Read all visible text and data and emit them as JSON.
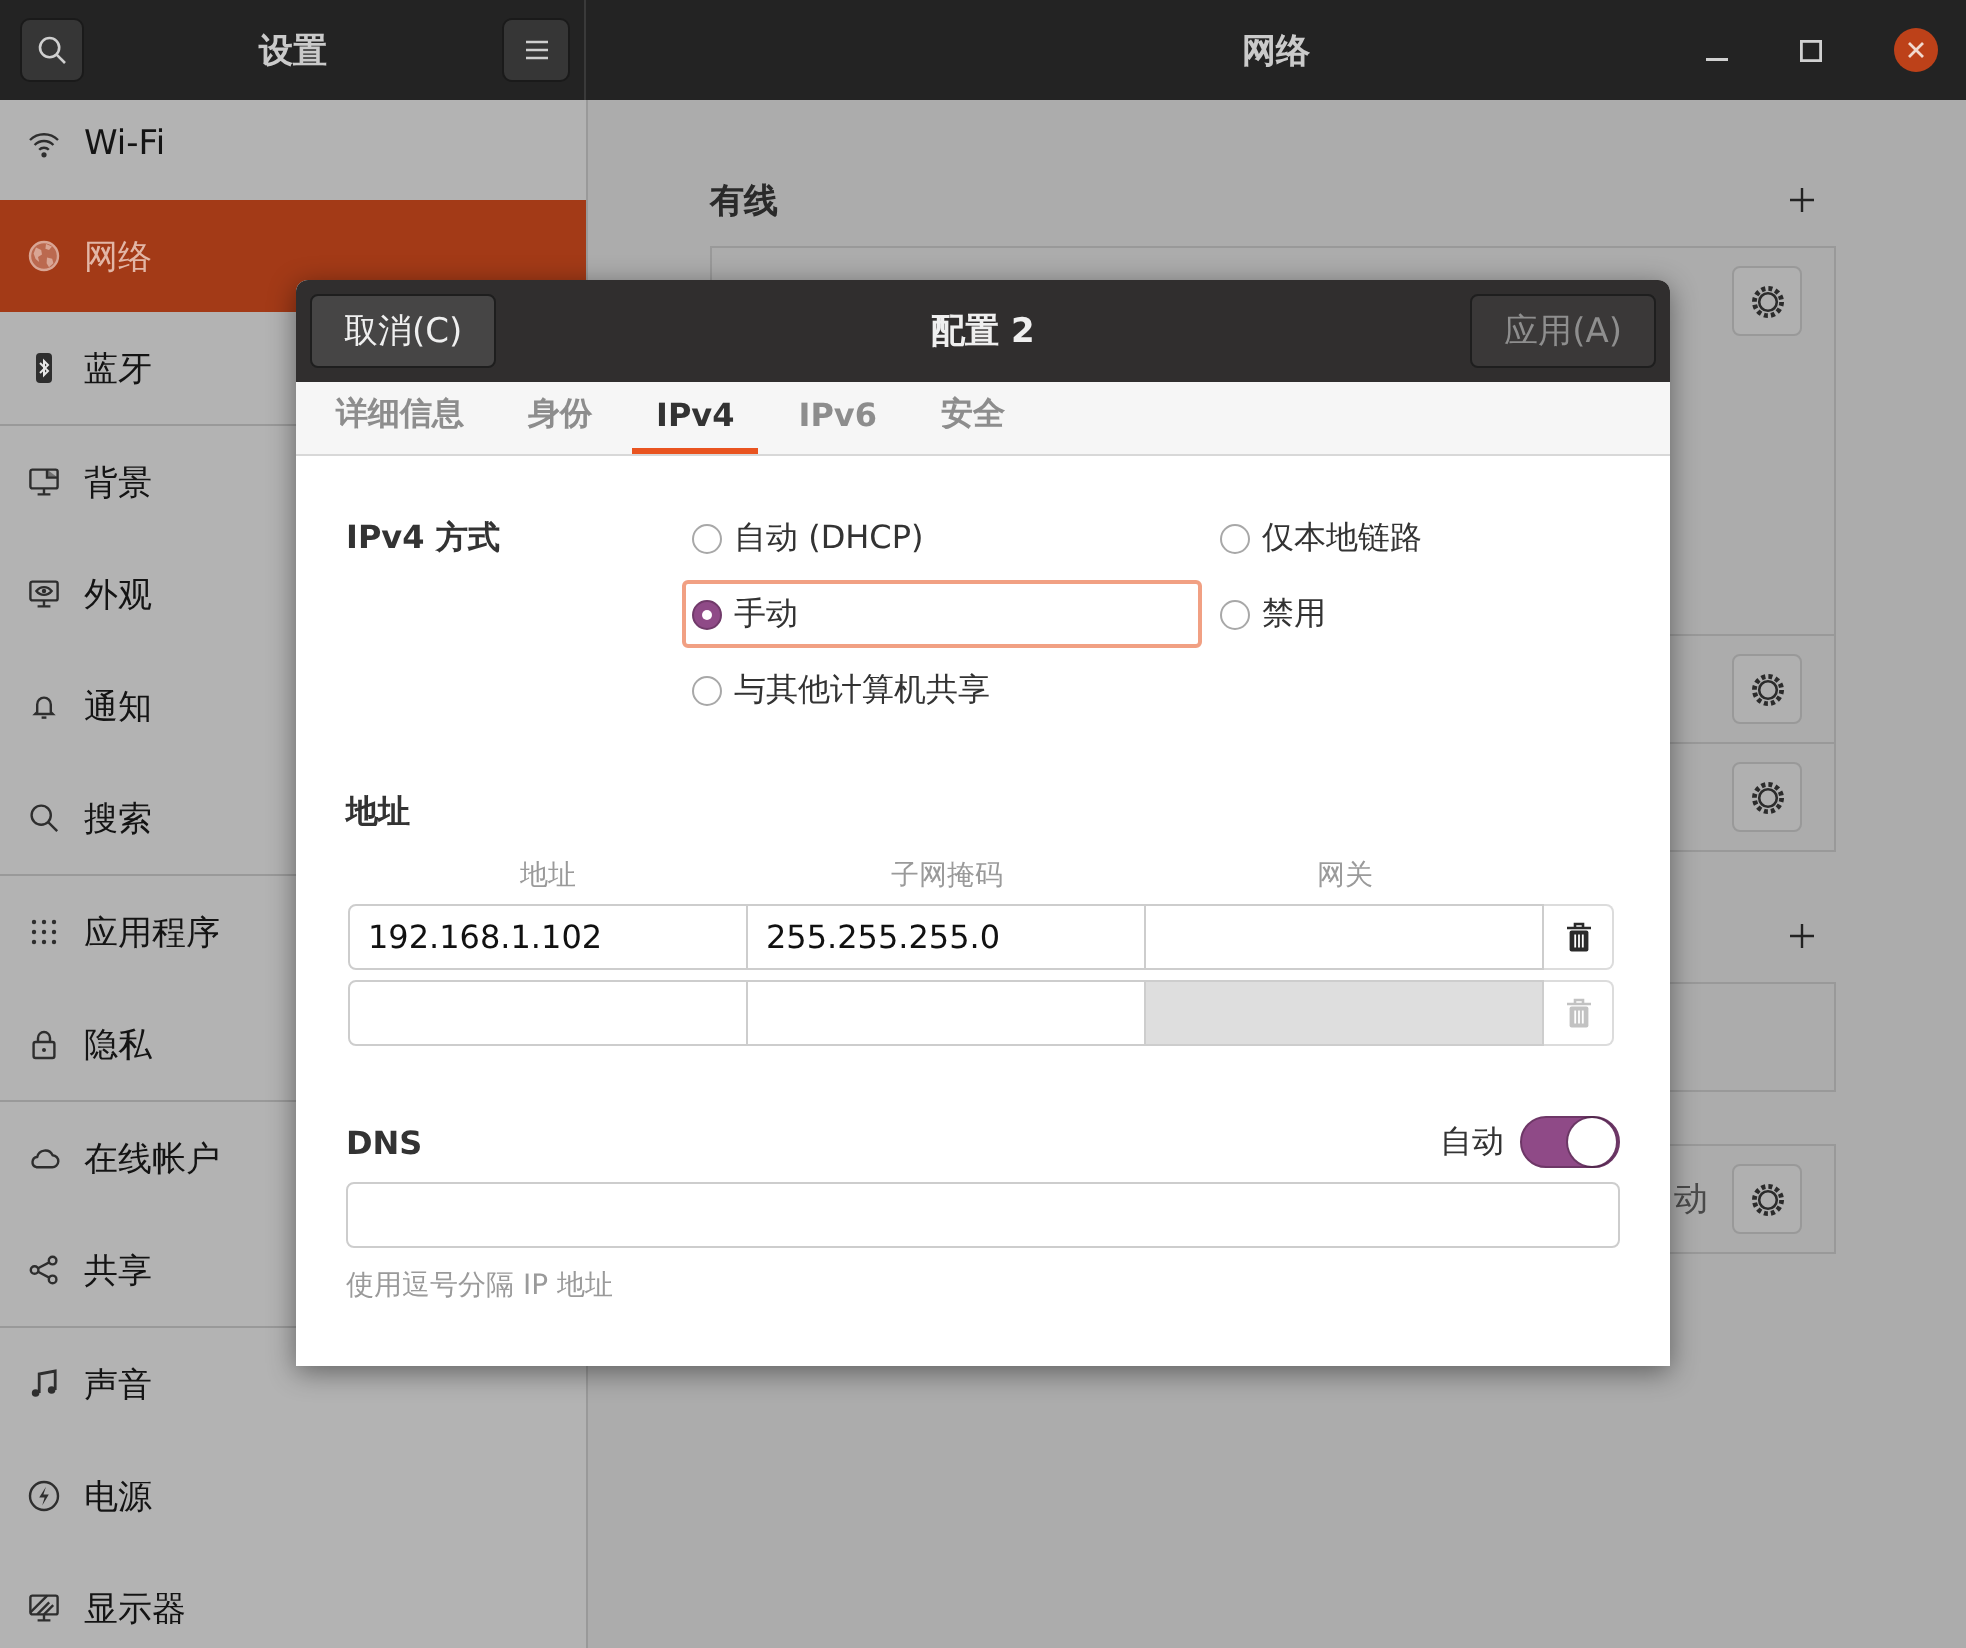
{
  "header": {
    "sidebar_title": "设置",
    "title": "网络"
  },
  "sidebar": {
    "groups": [
      {
        "items": [
          {
            "label": "Wi-Fi",
            "selected": false
          },
          {
            "label": "网络",
            "selected": true
          },
          {
            "label": "蓝牙",
            "selected": false
          }
        ]
      },
      {
        "items": [
          {
            "label": "背景",
            "selected": false
          },
          {
            "label": "外观",
            "selected": false
          },
          {
            "label": "通知",
            "selected": false
          },
          {
            "label": "搜索",
            "selected": false
          }
        ]
      },
      {
        "items": [
          {
            "label": "应用程序",
            "selected": false
          },
          {
            "label": "隐私",
            "selected": false
          }
        ]
      },
      {
        "items": [
          {
            "label": "在线帐户",
            "selected": false
          },
          {
            "label": "共享",
            "selected": false
          }
        ]
      },
      {
        "items": [
          {
            "label": "声音",
            "selected": false
          },
          {
            "label": "电源",
            "selected": false
          },
          {
            "label": "显示器",
            "selected": false
          }
        ]
      }
    ]
  },
  "network": {
    "sections": [
      {
        "heading": "有线",
        "add": true,
        "rows": [
          {
            "kind": "detail"
          },
          {
            "kind": "settings"
          },
          {
            "kind": "settings"
          }
        ]
      },
      {
        "add": true,
        "rows": [
          {
            "kind": "empty"
          }
        ]
      },
      {
        "add": false,
        "rows": [
          {
            "kind": "settings",
            "value": "动"
          }
        ]
      }
    ]
  },
  "dialog": {
    "cancel": "取消(C)",
    "title": "配置 2",
    "apply": {
      "label": "应用(A)",
      "disabled": true
    },
    "tabs": [
      {
        "label": "详细信息",
        "selected": false
      },
      {
        "label": "身份",
        "selected": false
      },
      {
        "label": "IPv4",
        "selected": true
      },
      {
        "label": "IPv6",
        "selected": false
      },
      {
        "label": "安全",
        "selected": false
      }
    ],
    "method": {
      "label": "IPv4 方式",
      "options": [
        {
          "label": "自动 (DHCP)",
          "selected": false,
          "focused": false
        },
        {
          "label": "仅本地链路",
          "selected": false,
          "focused": false
        },
        {
          "label": "手动",
          "selected": true,
          "focused": true
        },
        {
          "label": "禁用",
          "selected": false,
          "focused": false
        },
        {
          "label": "与其他计算机共享",
          "selected": false,
          "focused": false
        }
      ]
    },
    "addresses": {
      "label": "地址",
      "columns": [
        "地址",
        "子网掩码",
        "网关"
      ],
      "rows": [
        {
          "address": "192.168.1.102",
          "netmask": "255.255.255.0",
          "gateway_disabled": false,
          "delete_disabled": false
        },
        {
          "gateway_disabled": true,
          "delete_disabled": true
        }
      ]
    },
    "dns": {
      "label": "DNS",
      "auto_label": "自动",
      "auto": true,
      "hint": "使用逗号分隔 IP 地址"
    }
  }
}
